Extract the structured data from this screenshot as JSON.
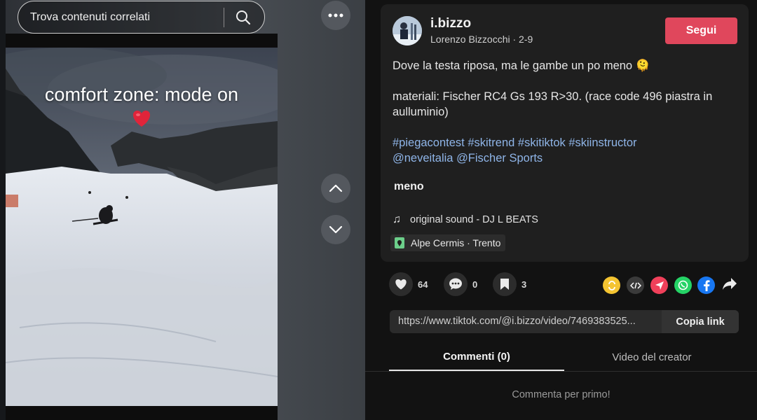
{
  "search": {
    "placeholder": "Trova contenuti correlati",
    "icon": "search-icon"
  },
  "video": {
    "caption": "comfort zone: mode on",
    "caption_emoji": "heart-emoji",
    "controls": {
      "more": "more-options-icon",
      "prev": "chevron-up-icon",
      "next": "chevron-down-icon"
    }
  },
  "author": {
    "username": "i.bizzo",
    "subline": "Lorenzo Bizzocchi · 2-9",
    "follow_label": "Segui",
    "follow_color": "#e0475c"
  },
  "description": {
    "line1": "Dove la testa riposa, ma le gambe un po meno 🫠",
    "materials": "materiali: Fischer RC4 Gs 193 R>30. (race code 496 piastra in aulluminio)",
    "hashtags": [
      "#piegacontest",
      "#skitrend",
      "#skitiktok",
      "#skiinstructor"
    ],
    "mentions": [
      "@neveitalia",
      "@Fischer Sports"
    ],
    "more_label": "meno",
    "link_color": "#8fb5e8"
  },
  "music": {
    "icon": "music-note-icon",
    "label": "original sound - DJ L BEATS"
  },
  "location": {
    "icon": "location-pin-icon",
    "label": "Alpe Cermis · Trento"
  },
  "actions": {
    "likes": "64",
    "comments": "0",
    "saves": "3"
  },
  "share": [
    "repost-icon",
    "embed-icon",
    "send-icon",
    "whatsapp-icon",
    "facebook-icon",
    "forward-icon"
  ],
  "link": {
    "url": "https://www.tiktok.com/@i.bizzo/video/7469383525...",
    "copy_label": "Copia link"
  },
  "tabs": [
    {
      "label": "Commenti (0)",
      "active": true
    },
    {
      "label": "Video del creator",
      "active": false
    }
  ],
  "comments_empty": "Commenta per primo!"
}
